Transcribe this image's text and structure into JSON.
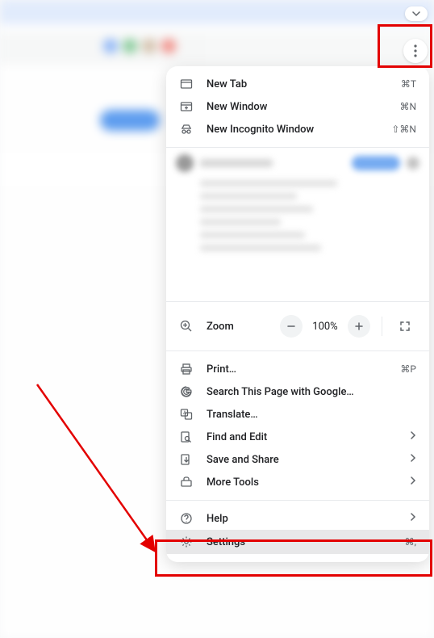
{
  "menu": {
    "section1": [
      {
        "icon": "new-tab-icon",
        "label": "New Tab",
        "shortcut": "⌘T"
      },
      {
        "icon": "new-window-icon",
        "label": "New Window",
        "shortcut": "⌘N"
      },
      {
        "icon": "incognito-icon",
        "label": "New Incognito Window",
        "shortcut": "⇧⌘N"
      }
    ],
    "zoom": {
      "label": "Zoom",
      "value": "100%"
    },
    "section3": [
      {
        "icon": "print-icon",
        "label": "Print…",
        "shortcut": "⌘P"
      },
      {
        "icon": "google-icon",
        "label": "Search This Page with Google…"
      },
      {
        "icon": "translate-icon",
        "label": "Translate…"
      },
      {
        "icon": "find-icon",
        "label": "Find and Edit",
        "chevron": true
      },
      {
        "icon": "save-share-icon",
        "label": "Save and Share",
        "chevron": true
      },
      {
        "icon": "more-tools-icon",
        "label": "More Tools",
        "chevron": true
      }
    ],
    "section4": [
      {
        "icon": "help-icon",
        "label": "Help",
        "chevron": true
      },
      {
        "icon": "settings-icon",
        "label": "Settings",
        "shortcut": "⌘,",
        "highlighted": true
      }
    ]
  }
}
